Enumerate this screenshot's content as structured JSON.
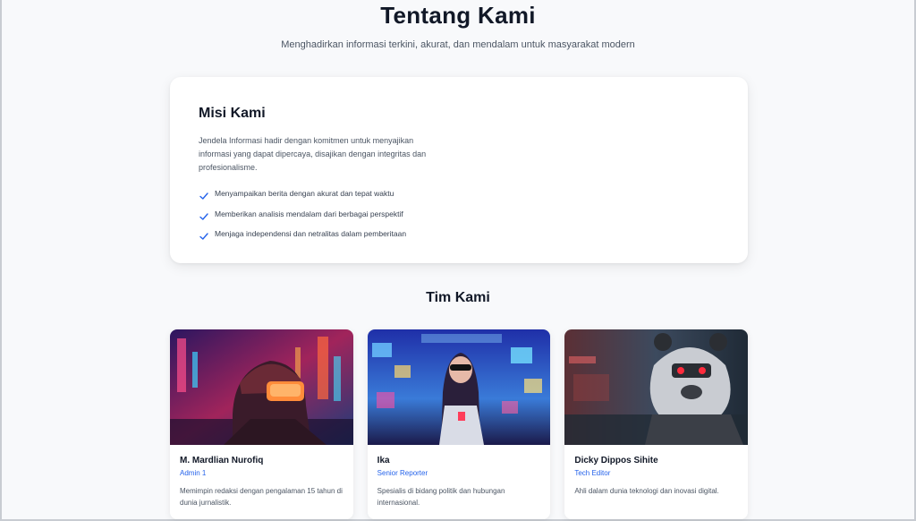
{
  "hero": {
    "title": "Tentang Kami",
    "subtitle": "Menghadirkan informasi terkini, akurat, dan mendalam untuk masyarakat modern"
  },
  "mission": {
    "title": "Misi Kami",
    "description": "Jendela Informasi hadir dengan komitmen untuk menyajikan informasi yang dapat dipercaya, disajikan dengan integritas dan profesionalisme.",
    "items": [
      "Menyampaikan berita dengan akurat dan tepat waktu",
      "Memberikan analisis mendalam dari berbagai perspektif",
      "Menjaga independensi dan netralitas dalam pemberitaan"
    ]
  },
  "team": {
    "title": "Tim Kami",
    "members": [
      {
        "name": "M. Mardlian Nurofiq",
        "role": "Admin 1",
        "bio": "Memimpin redaksi dengan pengalaman 15 tahun di dunia jurnalistik."
      },
      {
        "name": "Ika",
        "role": "Senior Reporter",
        "bio": "Spesialis di bidang politik dan hubungan internasional."
      },
      {
        "name": "Dicky Dippos Sihite",
        "role": "Tech Editor",
        "bio": "Ahli dalam dunia teknologi dan inovasi digital."
      }
    ]
  },
  "colors": {
    "accent": "#2563eb",
    "check": "#2563eb"
  },
  "icons": {
    "list_marker": "checkmark-icon"
  }
}
